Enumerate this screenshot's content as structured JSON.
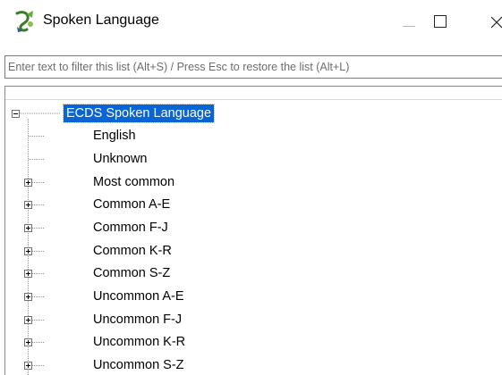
{
  "window": {
    "title": "Spoken Language"
  },
  "filter": {
    "placeholder": "Enter text to filter this list (Alt+S) / Press Esc to restore the list (Alt+L)",
    "value": ""
  },
  "tree": {
    "root": {
      "label": "ECDS Spoken Language",
      "expanded": true,
      "selected": true
    },
    "children": [
      {
        "label": "English",
        "expandable": false
      },
      {
        "label": "Unknown",
        "expandable": false
      },
      {
        "label": "Most common",
        "expandable": true
      },
      {
        "label": "Common A-E",
        "expandable": true
      },
      {
        "label": "Common F-J",
        "expandable": true
      },
      {
        "label": "Common K-R",
        "expandable": true
      },
      {
        "label": "Common S-Z",
        "expandable": true
      },
      {
        "label": "Uncommon A-E",
        "expandable": true
      },
      {
        "label": "Uncommon F-J",
        "expandable": true
      },
      {
        "label": "Uncommon K-R",
        "expandable": true
      },
      {
        "label": "Uncommon S-Z",
        "expandable": true
      }
    ]
  },
  "colors": {
    "selection": "#0a64d4",
    "tree_lines": "#808080"
  }
}
